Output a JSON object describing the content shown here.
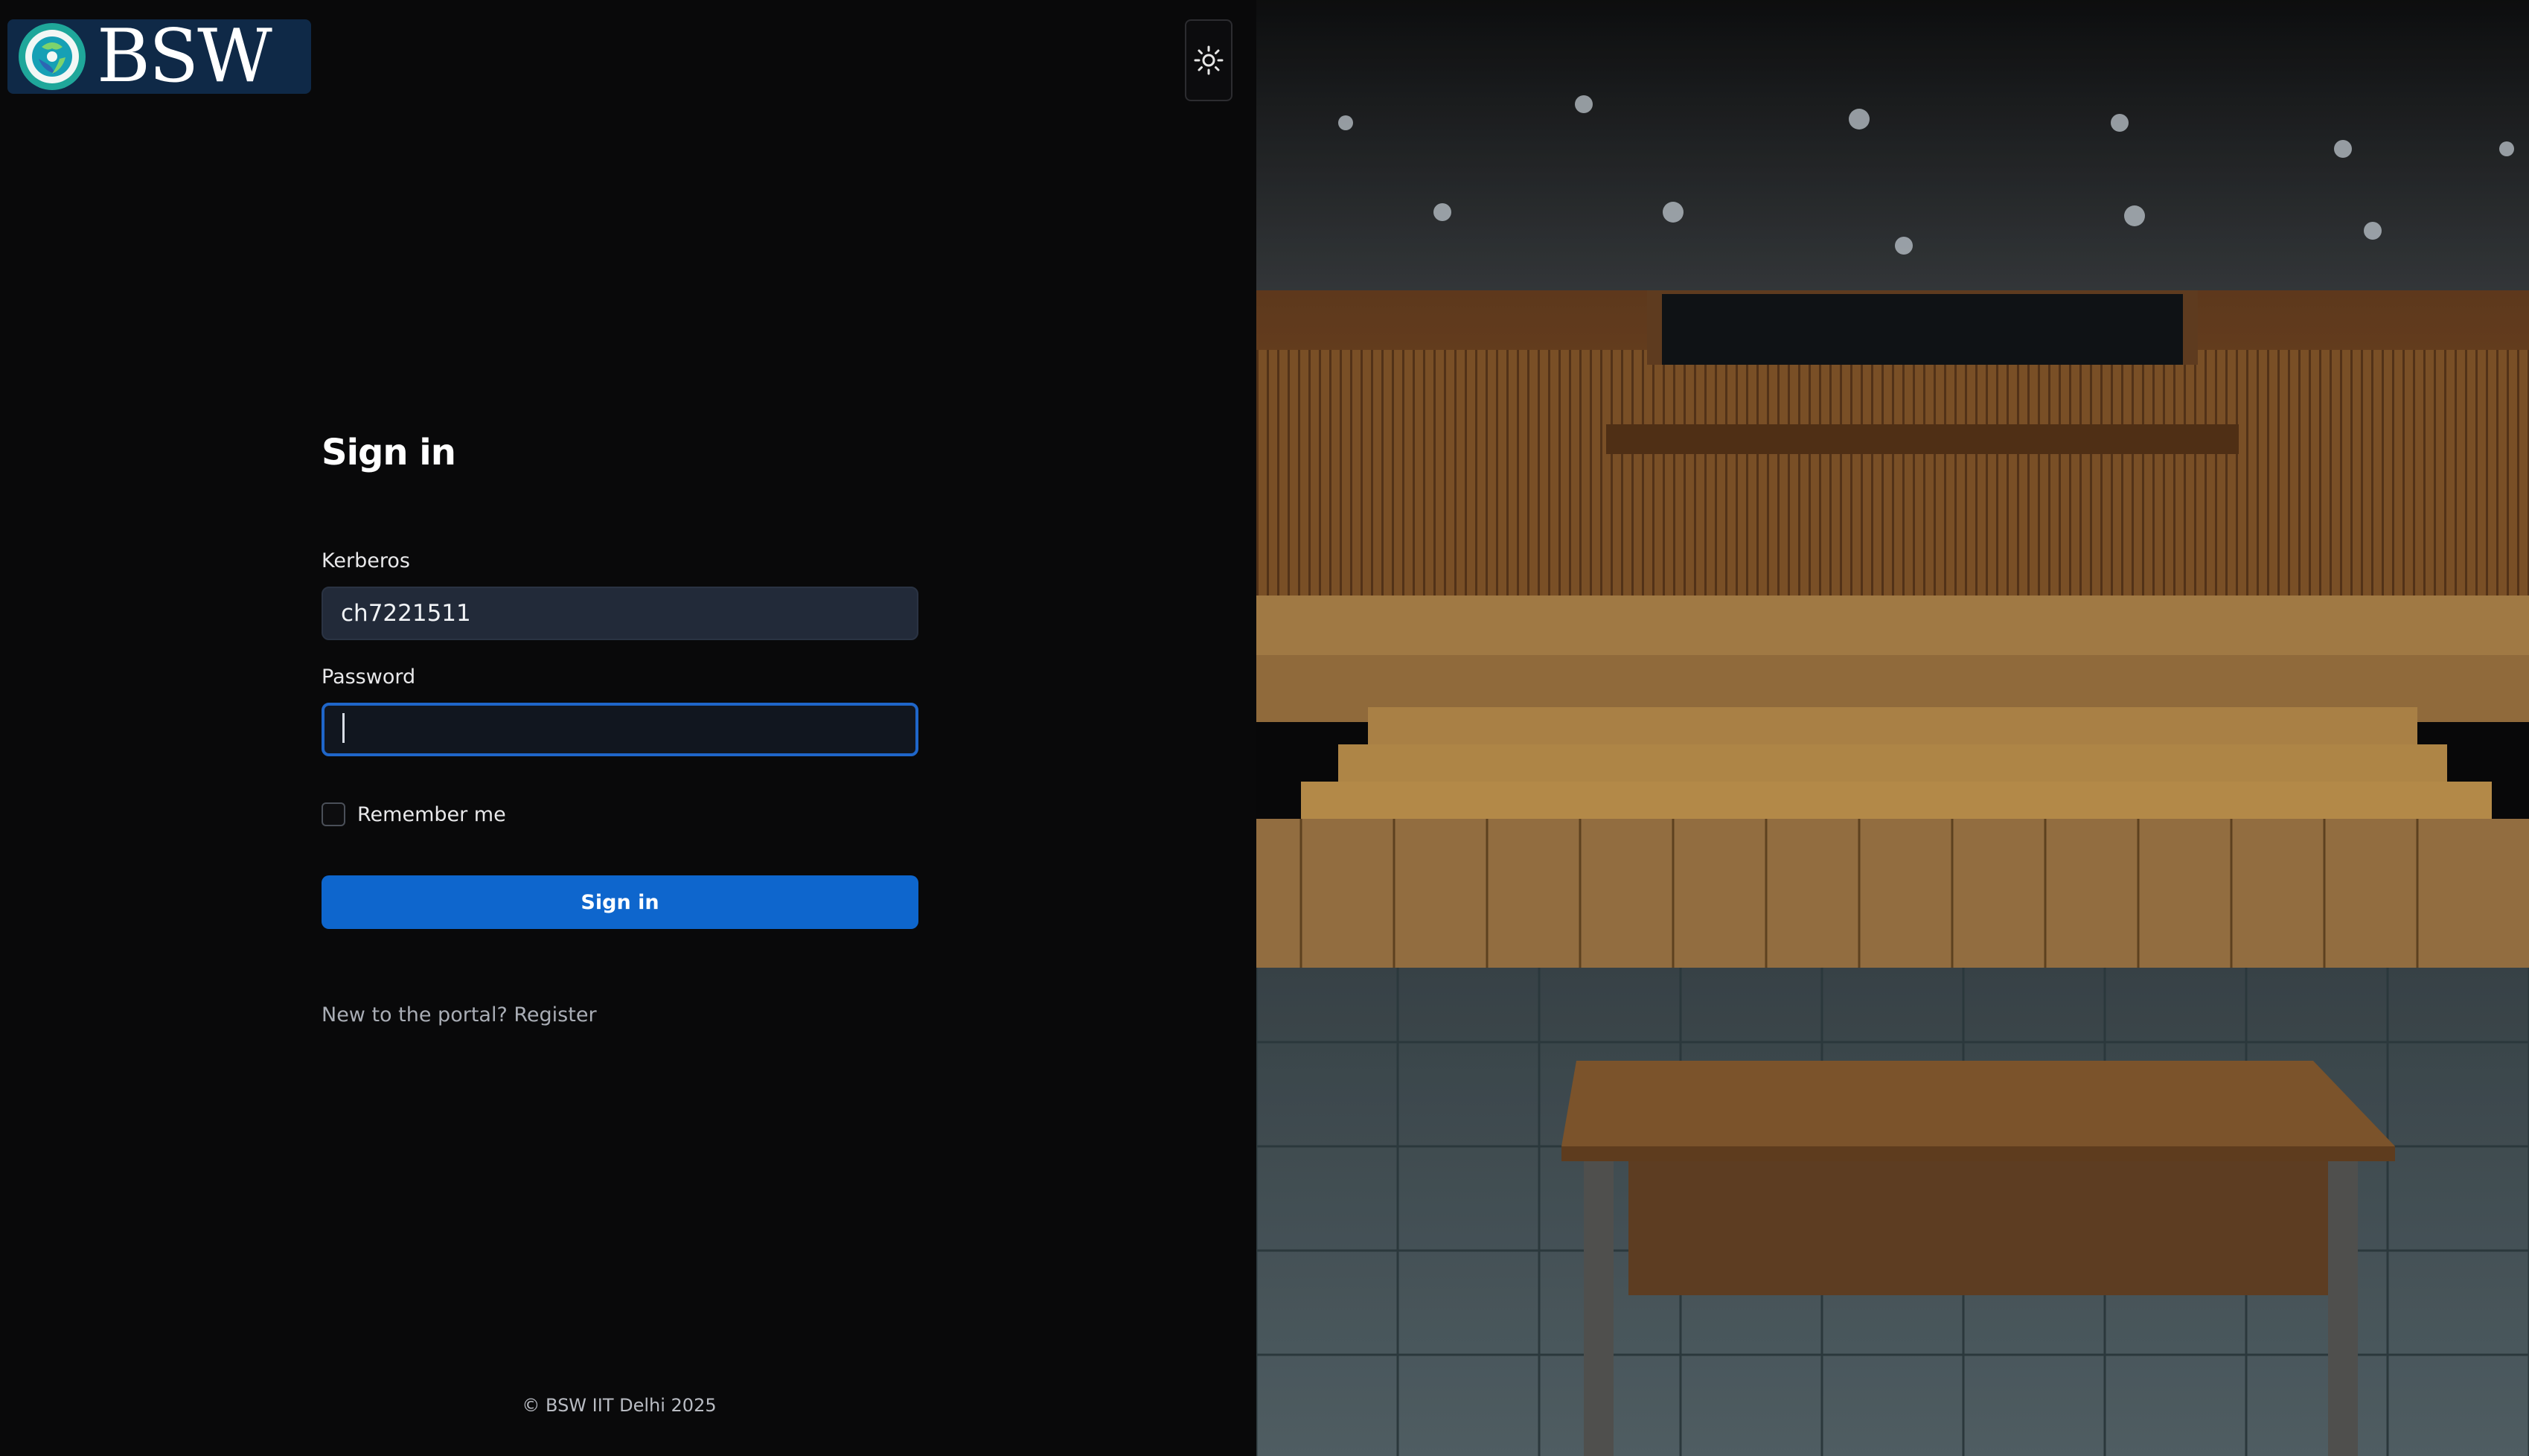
{
  "brand": {
    "logo_text": "BSW"
  },
  "theme_toggle": {
    "icon": "sun-icon"
  },
  "form": {
    "title": "Sign in",
    "kerberos_label": "Kerberos",
    "kerberos_value": "ch7221511",
    "password_label": "Password",
    "password_value": "",
    "remember_label": "Remember me",
    "remember_checked": false,
    "submit_label": "Sign in",
    "register_prompt": "New to the portal?",
    "register_link": "Register"
  },
  "footer": {
    "text": "© BSW IIT Delhi 2025"
  },
  "colors": {
    "background": "#09090a",
    "accent": "#0e66cd",
    "input_bg": "#222a39",
    "focus_border": "#1f66c9"
  },
  "hero_image": {
    "subject": "auditorium-photo"
  }
}
